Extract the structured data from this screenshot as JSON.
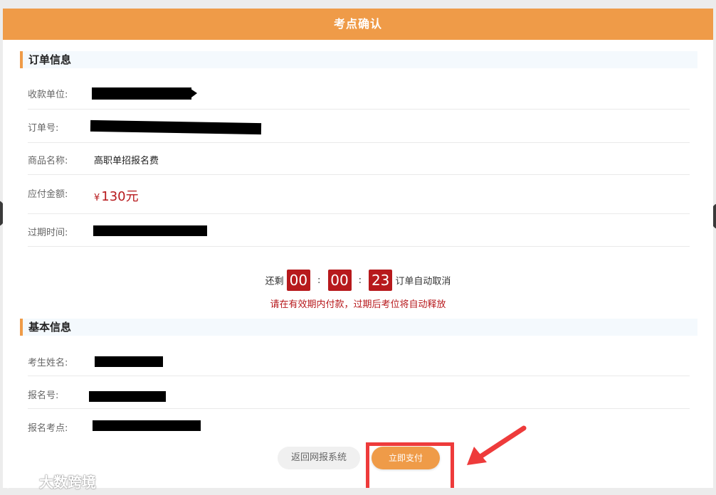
{
  "modal": {
    "title": "考点确认"
  },
  "order": {
    "section_title": "订单信息",
    "payee_label": "收款单位:",
    "order_no_label": "订单号:",
    "product_label": "商品名称:",
    "product_value": "高职单招报名费",
    "amount_label": "应付金额:",
    "currency_symbol": "¥",
    "amount_value": "130元",
    "expire_label": "过期时间:"
  },
  "countdown": {
    "prefix": "还剩",
    "hours": "00",
    "minutes": "00",
    "seconds": "23",
    "separator": ":",
    "suffix": "订单自动取消",
    "notice": "请在有效期内付款，过期后考位将自动释放"
  },
  "basic": {
    "section_title": "基本信息",
    "name_label": "考生姓名:",
    "reg_no_label": "报名号:",
    "exam_site_label": "报名考点:"
  },
  "actions": {
    "back_label": "返回网报系统",
    "pay_label": "立即支付"
  },
  "watermark": {
    "text": "大数跨境"
  },
  "colors": {
    "header": "#ef9b48",
    "accent_red": "#b7191c",
    "annotation": "#ee3b3b"
  }
}
